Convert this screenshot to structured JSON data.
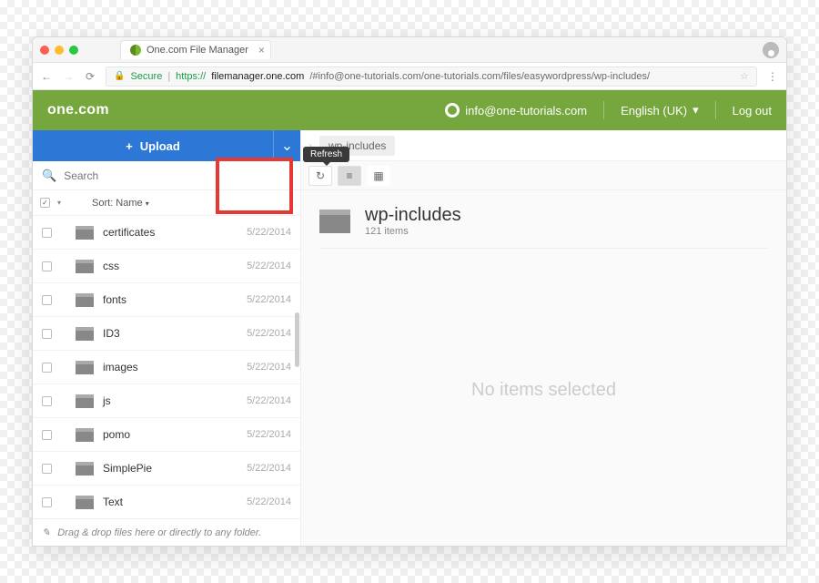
{
  "browser": {
    "tab_title": "One.com File Manager",
    "secure_label": "Secure",
    "url_scheme": "https://",
    "url_domain": "filemanager.one.com",
    "url_path": "/#info@one-tutorials.com/one-tutorials.com/files/easywordpress/wp-includes/"
  },
  "header": {
    "brand": "one.com",
    "account": "info@one-tutorials.com",
    "language": "English (UK)",
    "logout": "Log out"
  },
  "toolbar": {
    "upload_label": "Upload"
  },
  "search": {
    "placeholder": "Search"
  },
  "sort": {
    "label": "Sort: Name"
  },
  "breadcrumb": {
    "current": "wp-includes"
  },
  "tooltip": {
    "refresh": "Refresh"
  },
  "list": {
    "items": [
      {
        "name": "certificates",
        "date": "5/22/2014"
      },
      {
        "name": "css",
        "date": "5/22/2014"
      },
      {
        "name": "fonts",
        "date": "5/22/2014"
      },
      {
        "name": "ID3",
        "date": "5/22/2014"
      },
      {
        "name": "images",
        "date": "5/22/2014"
      },
      {
        "name": "js",
        "date": "5/22/2014"
      },
      {
        "name": "pomo",
        "date": "5/22/2014"
      },
      {
        "name": "SimplePie",
        "date": "5/22/2014"
      },
      {
        "name": "Text",
        "date": "5/22/2014"
      }
    ]
  },
  "drag_hint": "Drag & drop files here or directly to any folder.",
  "detail": {
    "title": "wp-includes",
    "subtitle": "121 items",
    "empty": "No items selected"
  }
}
